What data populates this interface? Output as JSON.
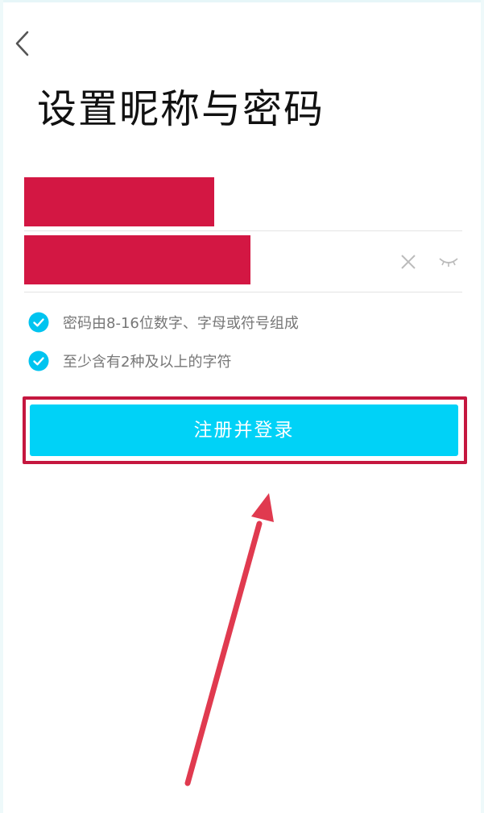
{
  "header": {
    "back_icon": "chevron-left-icon",
    "title": "设置昵称与密码"
  },
  "form": {
    "nickname_value": "",
    "password_value": "",
    "clear_icon": "close-icon",
    "visibility_icon": "eye-closed-icon"
  },
  "rules": [
    {
      "text": "密码由8-16位数字、字母或符号组成",
      "checked": true
    },
    {
      "text": "至少含有2种及以上的字符",
      "checked": true
    }
  ],
  "actions": {
    "submit_label": "注册并登录"
  },
  "colors": {
    "primary": "#00d2f7",
    "check": "#00c4f0",
    "redaction": "#d31743",
    "annotation": "#e03a4f"
  }
}
